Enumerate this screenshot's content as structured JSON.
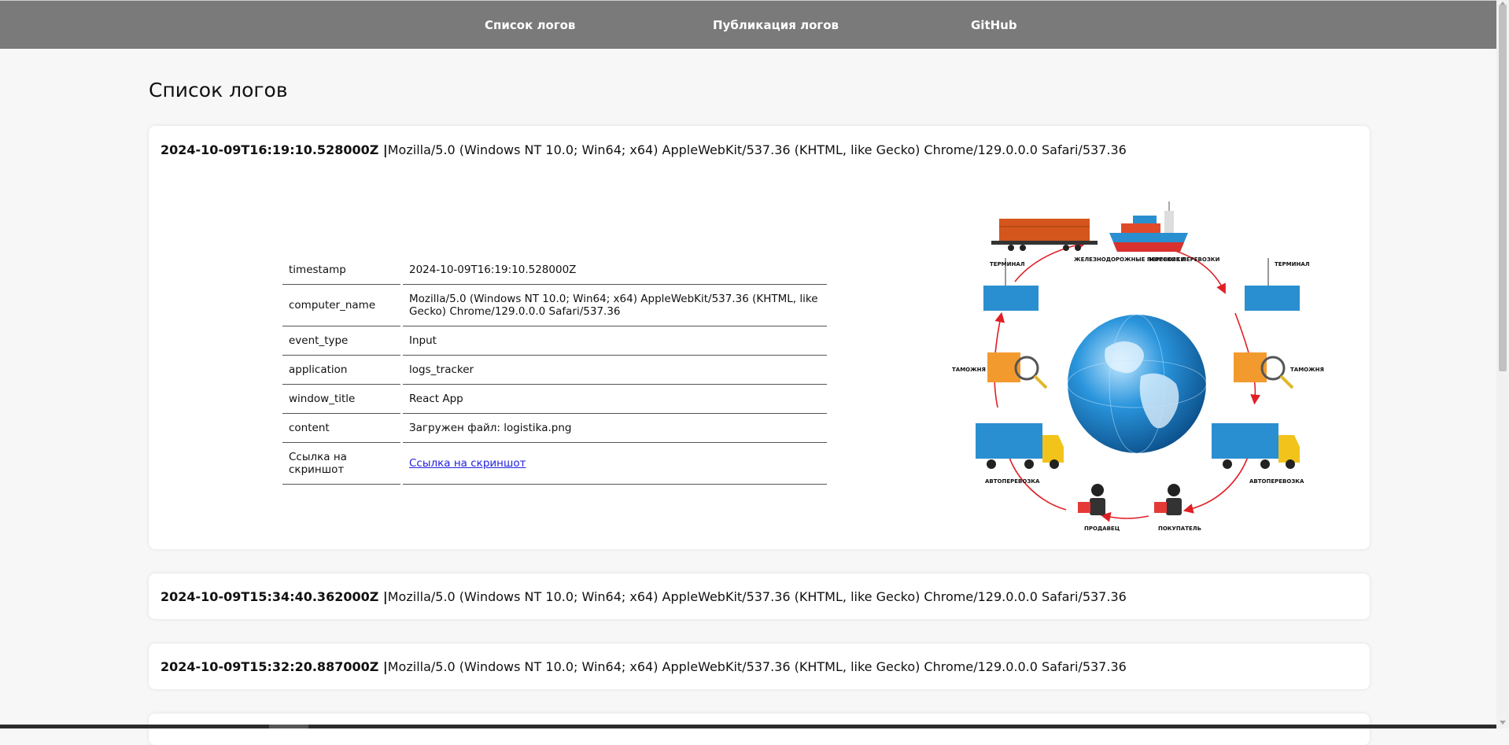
{
  "nav": {
    "links": [
      "Список логов",
      "Публикация логов",
      "GitHub"
    ]
  },
  "page": {
    "title": "Список логов"
  },
  "logs": [
    {
      "timestamp": "2024-10-09T16:19:10.528000Z |",
      "agent": "Mozilla/5.0 (Windows NT 10.0; Win64; x64) AppleWebKit/537.36 (KHTML, like Gecko) Chrome/129.0.0.0 Safari/537.36",
      "expanded": true,
      "details": [
        {
          "key": "timestamp",
          "value": "2024-10-09T16:19:10.528000Z"
        },
        {
          "key": "computer_name",
          "value": "Mozilla/5.0 (Windows NT 10.0; Win64; x64) AppleWebKit/537.36 (KHTML, like Gecko) Chrome/129.0.0.0 Safari/537.36"
        },
        {
          "key": "event_type",
          "value": "Input"
        },
        {
          "key": "application",
          "value": "logs_tracker"
        },
        {
          "key": "window_title",
          "value": "React App"
        },
        {
          "key": "content",
          "value": "Загружен файл: logistika.png"
        },
        {
          "key": "Ссылка на скриншот",
          "value": "Ссылка на скриншот"
        }
      ]
    },
    {
      "timestamp": "2024-10-09T15:34:40.362000Z |",
      "agent": "Mozilla/5.0 (Windows NT 10.0; Win64; x64) AppleWebKit/537.36 (KHTML, like Gecko) Chrome/129.0.0.0 Safari/537.36",
      "expanded": false
    },
    {
      "timestamp": "2024-10-09T15:32:20.887000Z |",
      "agent": "Mozilla/5.0 (Windows NT 10.0; Win64; x64) AppleWebKit/537.36 (KHTML, like Gecko) Chrome/129.0.0.0 Safari/537.36",
      "expanded": false
    }
  ],
  "illustration": {
    "labels": {
      "rail": "ЖЕЛЕЗНОДОРОЖНЫЕ ПЕРЕВОЗКИ",
      "sea": "МОРСКИЕ ПЕРЕВОЗКИ",
      "terminal_left": "ТЕРМИНАЛ",
      "terminal_right": "ТЕРМИНАЛ",
      "customs_left": "ТАМОЖНЯ",
      "customs_right": "ТАМОЖНЯ",
      "truck_left": "АВТОПЕРЕВОЗКА",
      "truck_right": "АВТОПЕРЕВОЗКА",
      "seller": "ПРОДАВЕЦ",
      "buyer": "ПОКУПАТЕЛЬ"
    },
    "colors": {
      "arrows": "#e01f25",
      "container": "#2a8fd0",
      "rail_car": "#d4561c",
      "globe": "#1a7cc4",
      "truck_cab": "#f2c31b"
    }
  }
}
